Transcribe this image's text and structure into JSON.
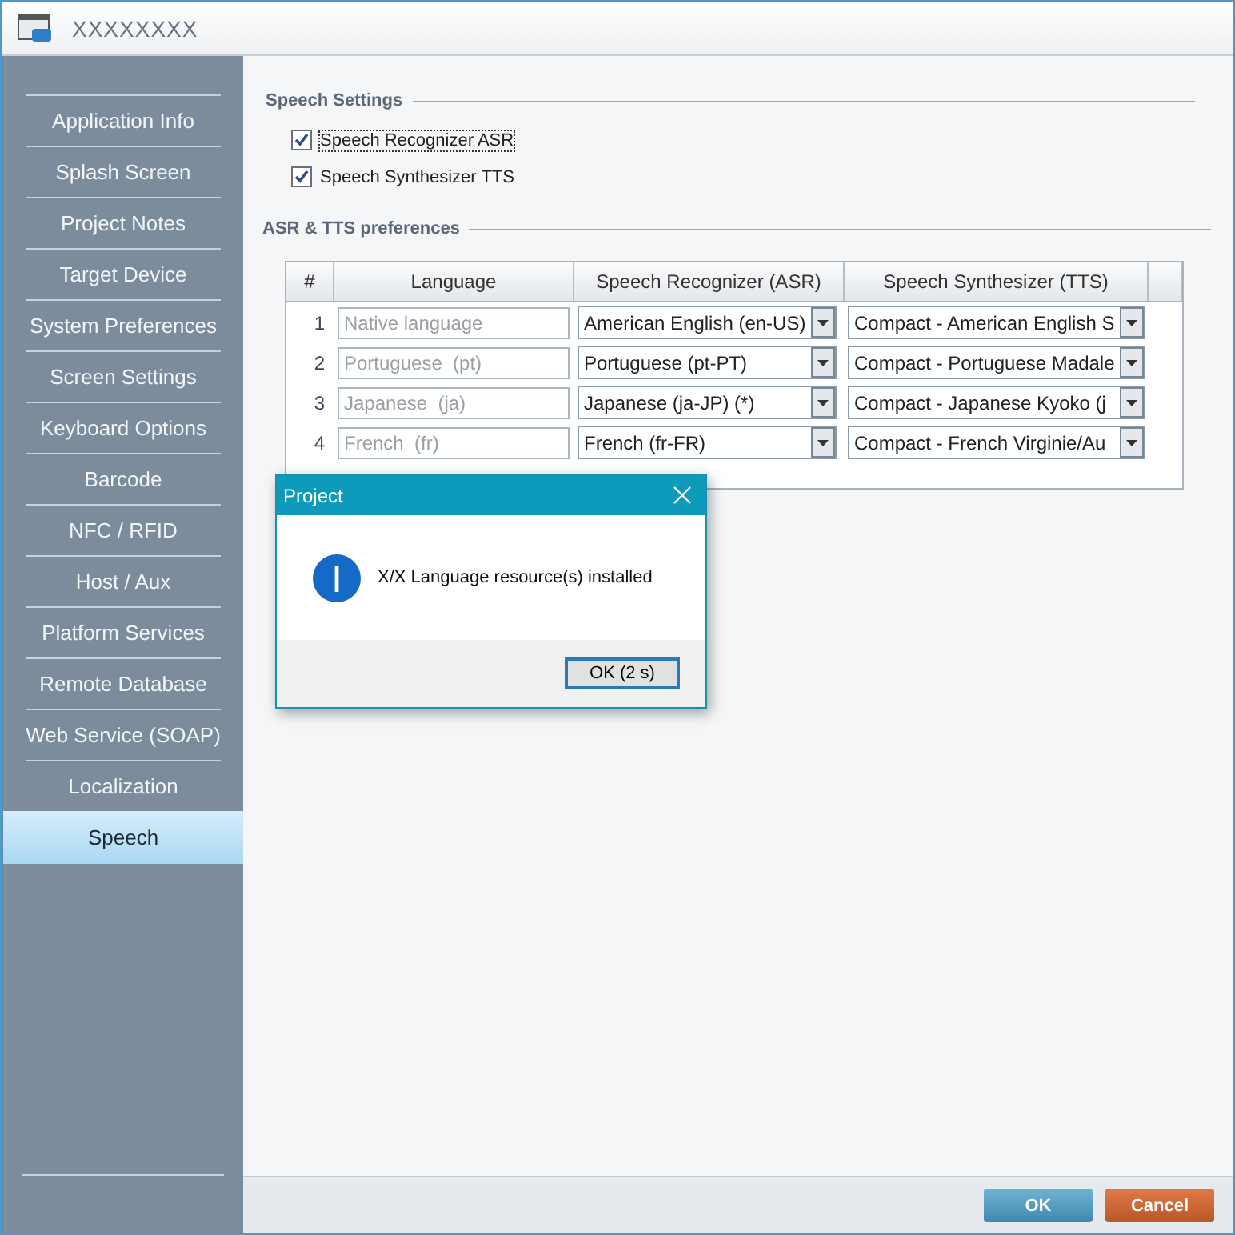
{
  "window": {
    "title": "XXXXXXXX"
  },
  "sidebar": {
    "items": [
      {
        "label": "Application Info",
        "selected": false
      },
      {
        "label": "Splash Screen",
        "selected": false
      },
      {
        "label": "Project Notes",
        "selected": false
      },
      {
        "label": "Target Device",
        "selected": false
      },
      {
        "label": "System Preferences",
        "selected": false
      },
      {
        "label": "Screen Settings",
        "selected": false
      },
      {
        "label": "Keyboard Options",
        "selected": false
      },
      {
        "label": "Barcode",
        "selected": false
      },
      {
        "label": "NFC / RFID",
        "selected": false
      },
      {
        "label": "Host / Aux",
        "selected": false
      },
      {
        "label": "Platform Services",
        "selected": false
      },
      {
        "label": "Remote Database",
        "selected": false
      },
      {
        "label": "Web Service (SOAP)",
        "selected": false
      },
      {
        "label": "Localization",
        "selected": false
      },
      {
        "label": "Speech",
        "selected": true
      }
    ]
  },
  "speech_settings": {
    "title": "Speech Settings",
    "options": [
      {
        "label": "Speech Recognizer ASR",
        "checked": true
      },
      {
        "label": "Speech Synthesizer TTS",
        "checked": true
      }
    ]
  },
  "preferences": {
    "title": "ASR & TTS preferences",
    "table": {
      "columns": [
        "#",
        "Language",
        "Speech Recognizer (ASR)",
        "Speech Synthesizer (TTS)"
      ],
      "rows": [
        {
          "number": "1",
          "language_placeholder": "Native language",
          "asr": "American English (en-US)",
          "tts": "Compact - American English S"
        },
        {
          "number": "2",
          "language_placeholder": "Portuguese  (pt)",
          "asr": "Portuguese (pt-PT)",
          "tts": "Compact - Portuguese Madale"
        },
        {
          "number": "3",
          "language_placeholder": "Japanese  (ja)",
          "asr": "Japanese (ja-JP) (*)",
          "tts": "Compact - Japanese Kyoko (j"
        },
        {
          "number": "4",
          "language_placeholder": "French  (fr)",
          "asr": "French (fr-FR)",
          "tts": "Compact - French Virginie/Au"
        }
      ]
    }
  },
  "dialog": {
    "title": "Project",
    "message": "X/X Language resource(s) installed",
    "button": "OK (2 s)"
  },
  "buttons": {
    "ok": "OK",
    "cancel": "Cancel"
  }
}
